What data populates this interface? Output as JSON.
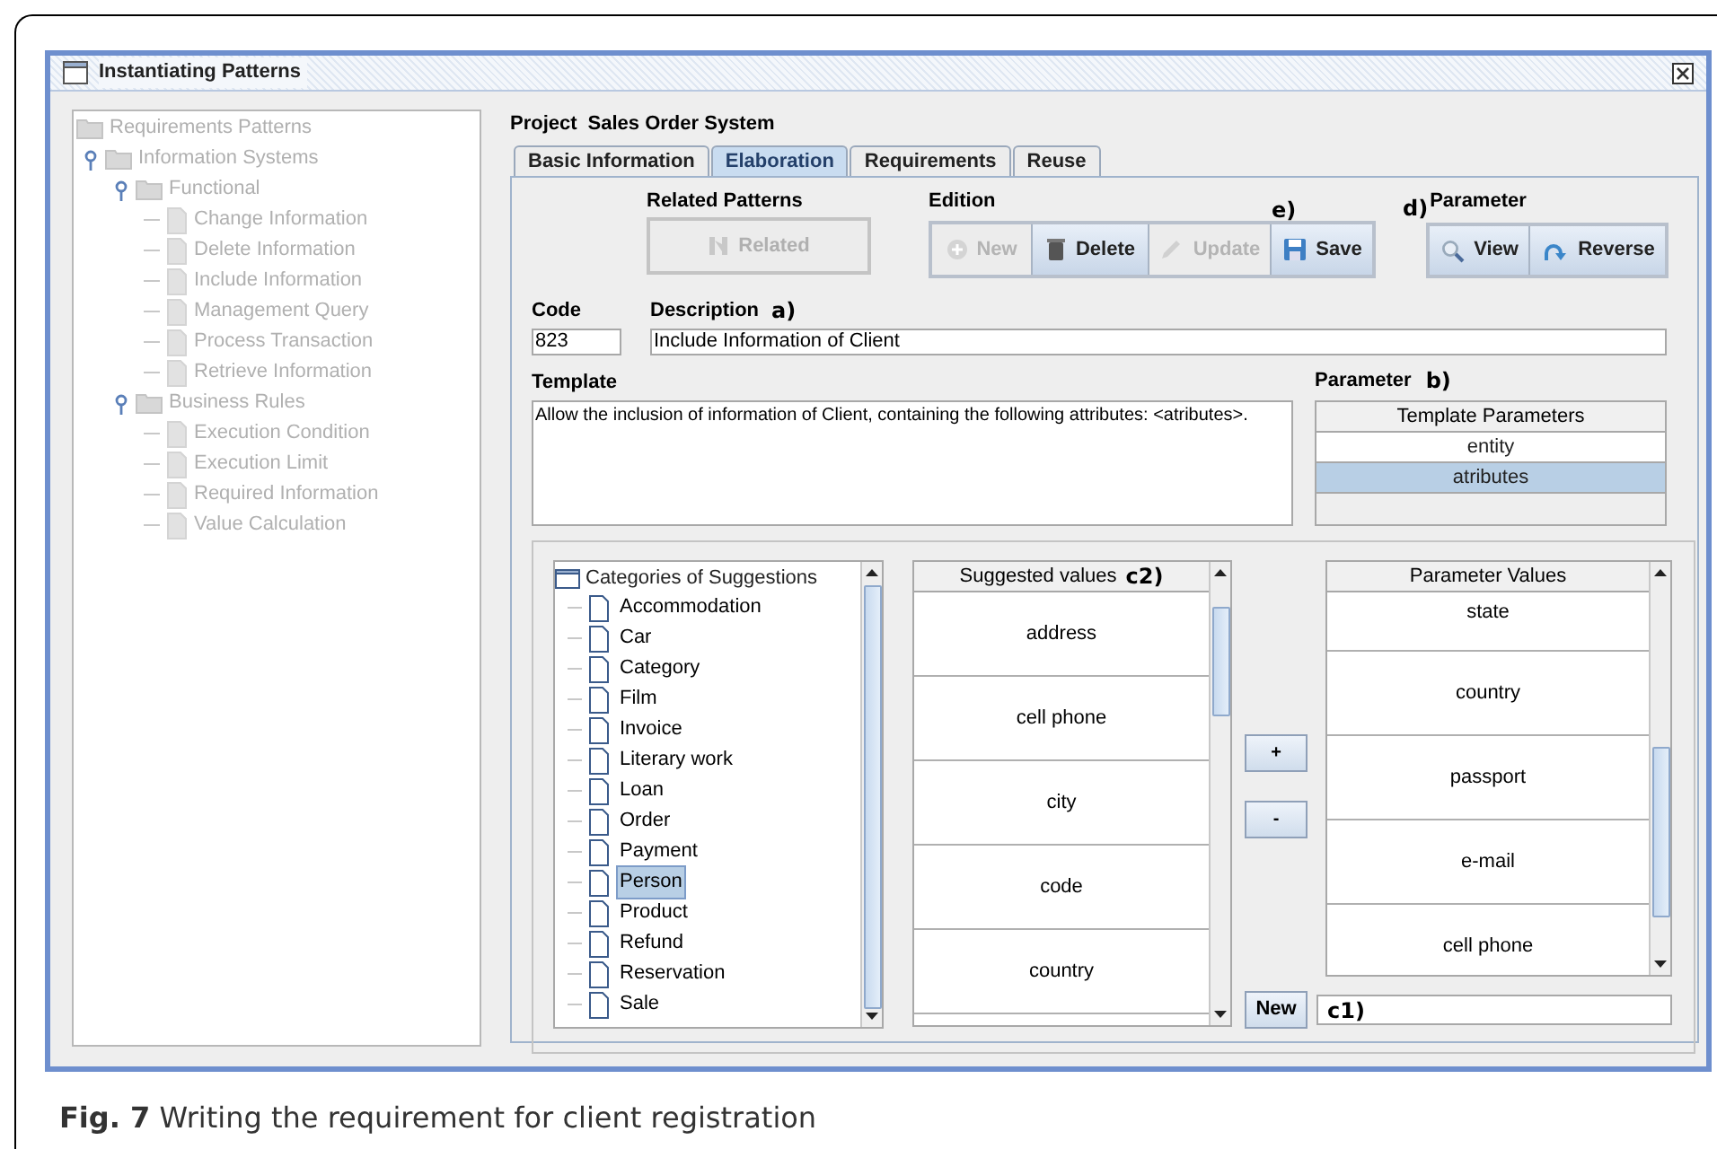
{
  "window": {
    "title": "Instantiating Patterns"
  },
  "pattern_tree": {
    "disabled": true,
    "items": [
      {
        "label": "Requirements Patterns",
        "kind": "folder",
        "children": [
          {
            "label": "Information Systems",
            "kind": "folder",
            "expanded": true,
            "children": [
              {
                "label": "Functional",
                "kind": "folder",
                "expanded": true,
                "children": [
                  {
                    "label": "Change Information",
                    "kind": "document"
                  },
                  {
                    "label": "Delete Information",
                    "kind": "document"
                  },
                  {
                    "label": "Include Information",
                    "kind": "document"
                  },
                  {
                    "label": "Management Query",
                    "kind": "document"
                  },
                  {
                    "label": "Process Transaction",
                    "kind": "document"
                  },
                  {
                    "label": "Retrieve Information",
                    "kind": "document"
                  }
                ]
              },
              {
                "label": "Business Rules",
                "kind": "folder",
                "expanded": true,
                "children": [
                  {
                    "label": "Execution Condition",
                    "kind": "document"
                  },
                  {
                    "label": "Execution Limit",
                    "kind": "document"
                  },
                  {
                    "label": "Required Information",
                    "kind": "document"
                  },
                  {
                    "label": "Value Calculation",
                    "kind": "document"
                  }
                ]
              }
            ]
          }
        ]
      }
    ]
  },
  "project": {
    "label": "Project",
    "value": "Sales Order System"
  },
  "tabs": [
    {
      "label": "Basic Information",
      "selected": false
    },
    {
      "label": "Elaboration",
      "selected": true
    },
    {
      "label": "Requirements",
      "selected": false
    },
    {
      "label": "Reuse",
      "selected": false
    }
  ],
  "related_patterns": {
    "label": "Related Patterns",
    "button": {
      "label": "Related",
      "disabled": true
    }
  },
  "edition": {
    "label": "Edition",
    "marker": "e)",
    "buttons": [
      {
        "label": "New",
        "kind": "new",
        "disabled": true
      },
      {
        "label": "Delete",
        "kind": "delete",
        "disabled": false
      },
      {
        "label": "Update",
        "kind": "update",
        "disabled": true
      },
      {
        "label": "Save",
        "kind": "save",
        "disabled": false
      }
    ]
  },
  "parameter_actions": {
    "marker": "d)",
    "label": "Parameter",
    "buttons": [
      {
        "label": "View",
        "kind": "view",
        "disabled": false
      },
      {
        "label": "Reverse",
        "kind": "reverse",
        "disabled": false
      }
    ]
  },
  "code": {
    "label": "Code",
    "value": "823"
  },
  "description": {
    "label": "Description",
    "marker": "a)",
    "value": "Include Information of Client"
  },
  "template": {
    "label": "Template",
    "value": "Allow the inclusion of information of Client, containing the following attributes: <atributes>."
  },
  "parameters": {
    "label": "Parameter",
    "marker": "b)",
    "header": "Template Parameters",
    "rows": [
      {
        "text": "entity",
        "selected": false
      },
      {
        "text": "atributes",
        "selected": true
      }
    ]
  },
  "categories": {
    "root": "Categories of Suggestions",
    "items": [
      {
        "label": "Accommodation",
        "selected": false
      },
      {
        "label": "Car",
        "selected": false
      },
      {
        "label": "Category",
        "selected": false
      },
      {
        "label": "Film",
        "selected": false
      },
      {
        "label": "Invoice",
        "selected": false
      },
      {
        "label": "Literary work",
        "selected": false
      },
      {
        "label": "Loan",
        "selected": false
      },
      {
        "label": "Order",
        "selected": false
      },
      {
        "label": "Payment",
        "selected": false
      },
      {
        "label": "Person",
        "selected": true
      },
      {
        "label": "Product",
        "selected": false
      },
      {
        "label": "Refund",
        "selected": false
      },
      {
        "label": "Reservation",
        "selected": false
      },
      {
        "label": "Sale",
        "selected": false
      }
    ]
  },
  "suggested_values": {
    "header": "Suggested values",
    "marker": "c2)",
    "rows": [
      "address",
      "cell phone",
      "city",
      "code",
      "country"
    ]
  },
  "add_button": "+",
  "remove_button": "-",
  "parameter_values": {
    "header": "Parameter Values",
    "rows": [
      "state",
      "country",
      "passport",
      "e-mail",
      "cell phone"
    ]
  },
  "new_value": {
    "button": "New",
    "marker": "c1)"
  },
  "caption": {
    "label": "Fig. 7",
    "text": "Writing the requirement for client registration"
  }
}
